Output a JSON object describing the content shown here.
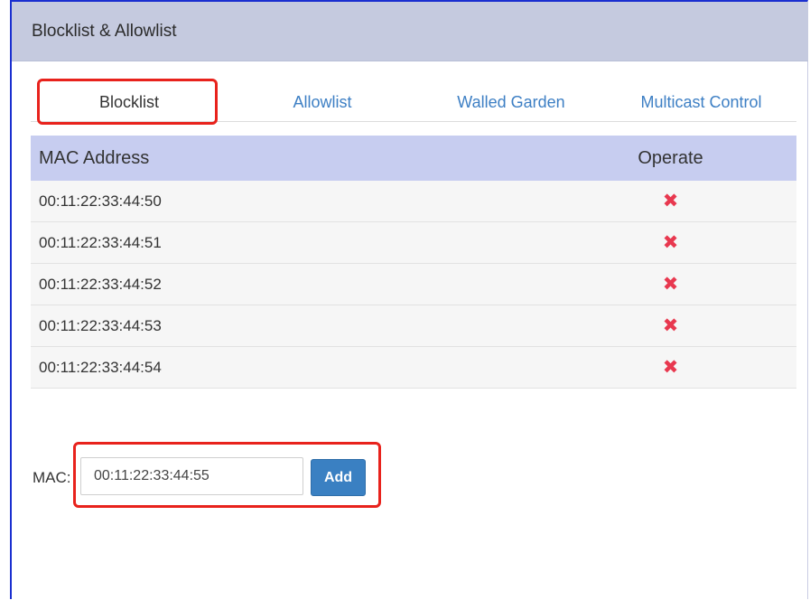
{
  "panel": {
    "title": "Blocklist & Allowlist"
  },
  "tabs": [
    {
      "label": "Blocklist",
      "active": true
    },
    {
      "label": "Allowlist",
      "active": false
    },
    {
      "label": "Walled Garden",
      "active": false
    },
    {
      "label": "Multicast Control",
      "active": false
    }
  ],
  "table": {
    "columns": [
      "MAC Address",
      "Operate"
    ],
    "rows": [
      {
        "mac": "00:11:22:33:44:50",
        "operate_icon": "delete-x-icon"
      },
      {
        "mac": "00:11:22:33:44:51",
        "operate_icon": "delete-x-icon"
      },
      {
        "mac": "00:11:22:33:44:52",
        "operate_icon": "delete-x-icon"
      },
      {
        "mac": "00:11:22:33:44:53",
        "operate_icon": "delete-x-icon"
      },
      {
        "mac": "00:11:22:33:44:54",
        "operate_icon": "delete-x-icon"
      }
    ]
  },
  "form": {
    "mac_label": "MAC:",
    "mac_value": "00:11:22:33:44:55",
    "add_label": "Add"
  },
  "colors": {
    "header_bg": "#c5cadf",
    "table_header_bg": "#c7cdf0",
    "link": "#3d7fc4",
    "delete_icon": "#e8384f",
    "highlight": "#e8221c",
    "button": "#3a80c2"
  }
}
